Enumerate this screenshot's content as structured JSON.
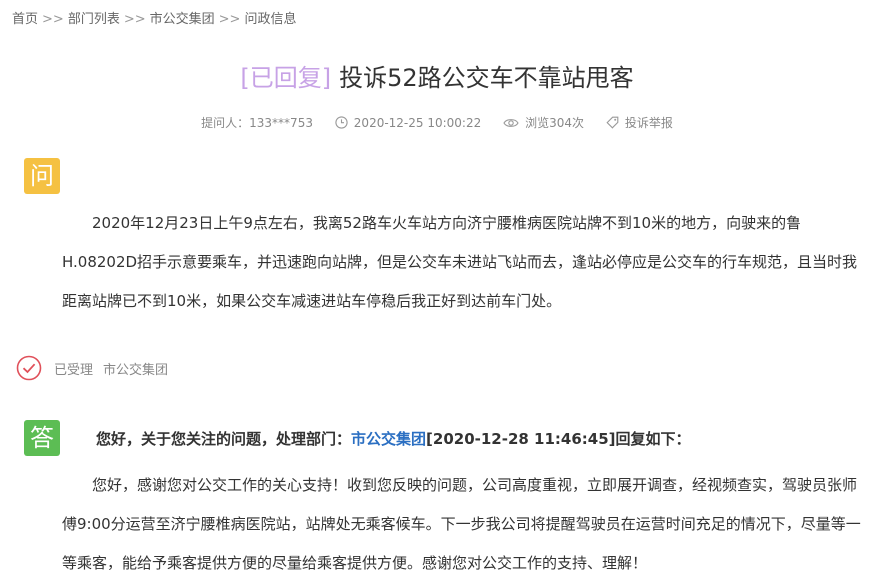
{
  "breadcrumb": {
    "items": [
      "首页",
      "部门列表",
      "市公交集团",
      "问政信息"
    ],
    "separator": ">>"
  },
  "title": {
    "badge": "[已回复]",
    "text": "投诉52路公交车不靠站甩客"
  },
  "meta": {
    "asker": "提问人：133***753",
    "time": "2020-12-25 10:00:22",
    "views": "浏览304次",
    "report": "投诉举报"
  },
  "question": {
    "tag": "问",
    "text": "2020年12月23日上午9点左右，我离52路车火车站方向济宁腰椎病医院站牌不到10米的地方，向驶来的鲁H.08202D招手示意要乘车，并迅速跑向站牌，但是公交车未进站飞站而去，逢站必停应是公交车的行车规范，且当时我距离站牌已不到10米，如果公交车减速进站车停稳后我正好到达前车门处。"
  },
  "status": {
    "label": "已受理",
    "department": "市公交集团"
  },
  "answer": {
    "tag": "答",
    "head_prefix": "您好，关于您关注的问题，处理部门：",
    "head_department": "市公交集团",
    "head_suffix": "[2020-12-28 11:46:45]回复如下：",
    "text": "您好，感谢您对公交工作的关心支持！收到您反映的问题，公司高度重视，立即展开调查，经视频查实，驾驶员张师傅9:00分运营至济宁腰椎病医院站，站牌处无乘客候车。下一步我公司将提醒驾驶员在运营时间充足的情况下，尽量等一等乘客，能给予乘客提供方便的尽量给乘客提供方便。感谢您对公交工作的支持、理解！"
  },
  "colors": {
    "badge": "#c7a2e6",
    "question_tag": "#f5c142",
    "answer_tag": "#5cbd54",
    "department_link": "#2b6fc2",
    "status_icon": "#e0505a"
  },
  "icons": {
    "time": "clock-icon",
    "views": "eye-icon",
    "report": "tag-icon",
    "status": "check-circle-icon"
  }
}
